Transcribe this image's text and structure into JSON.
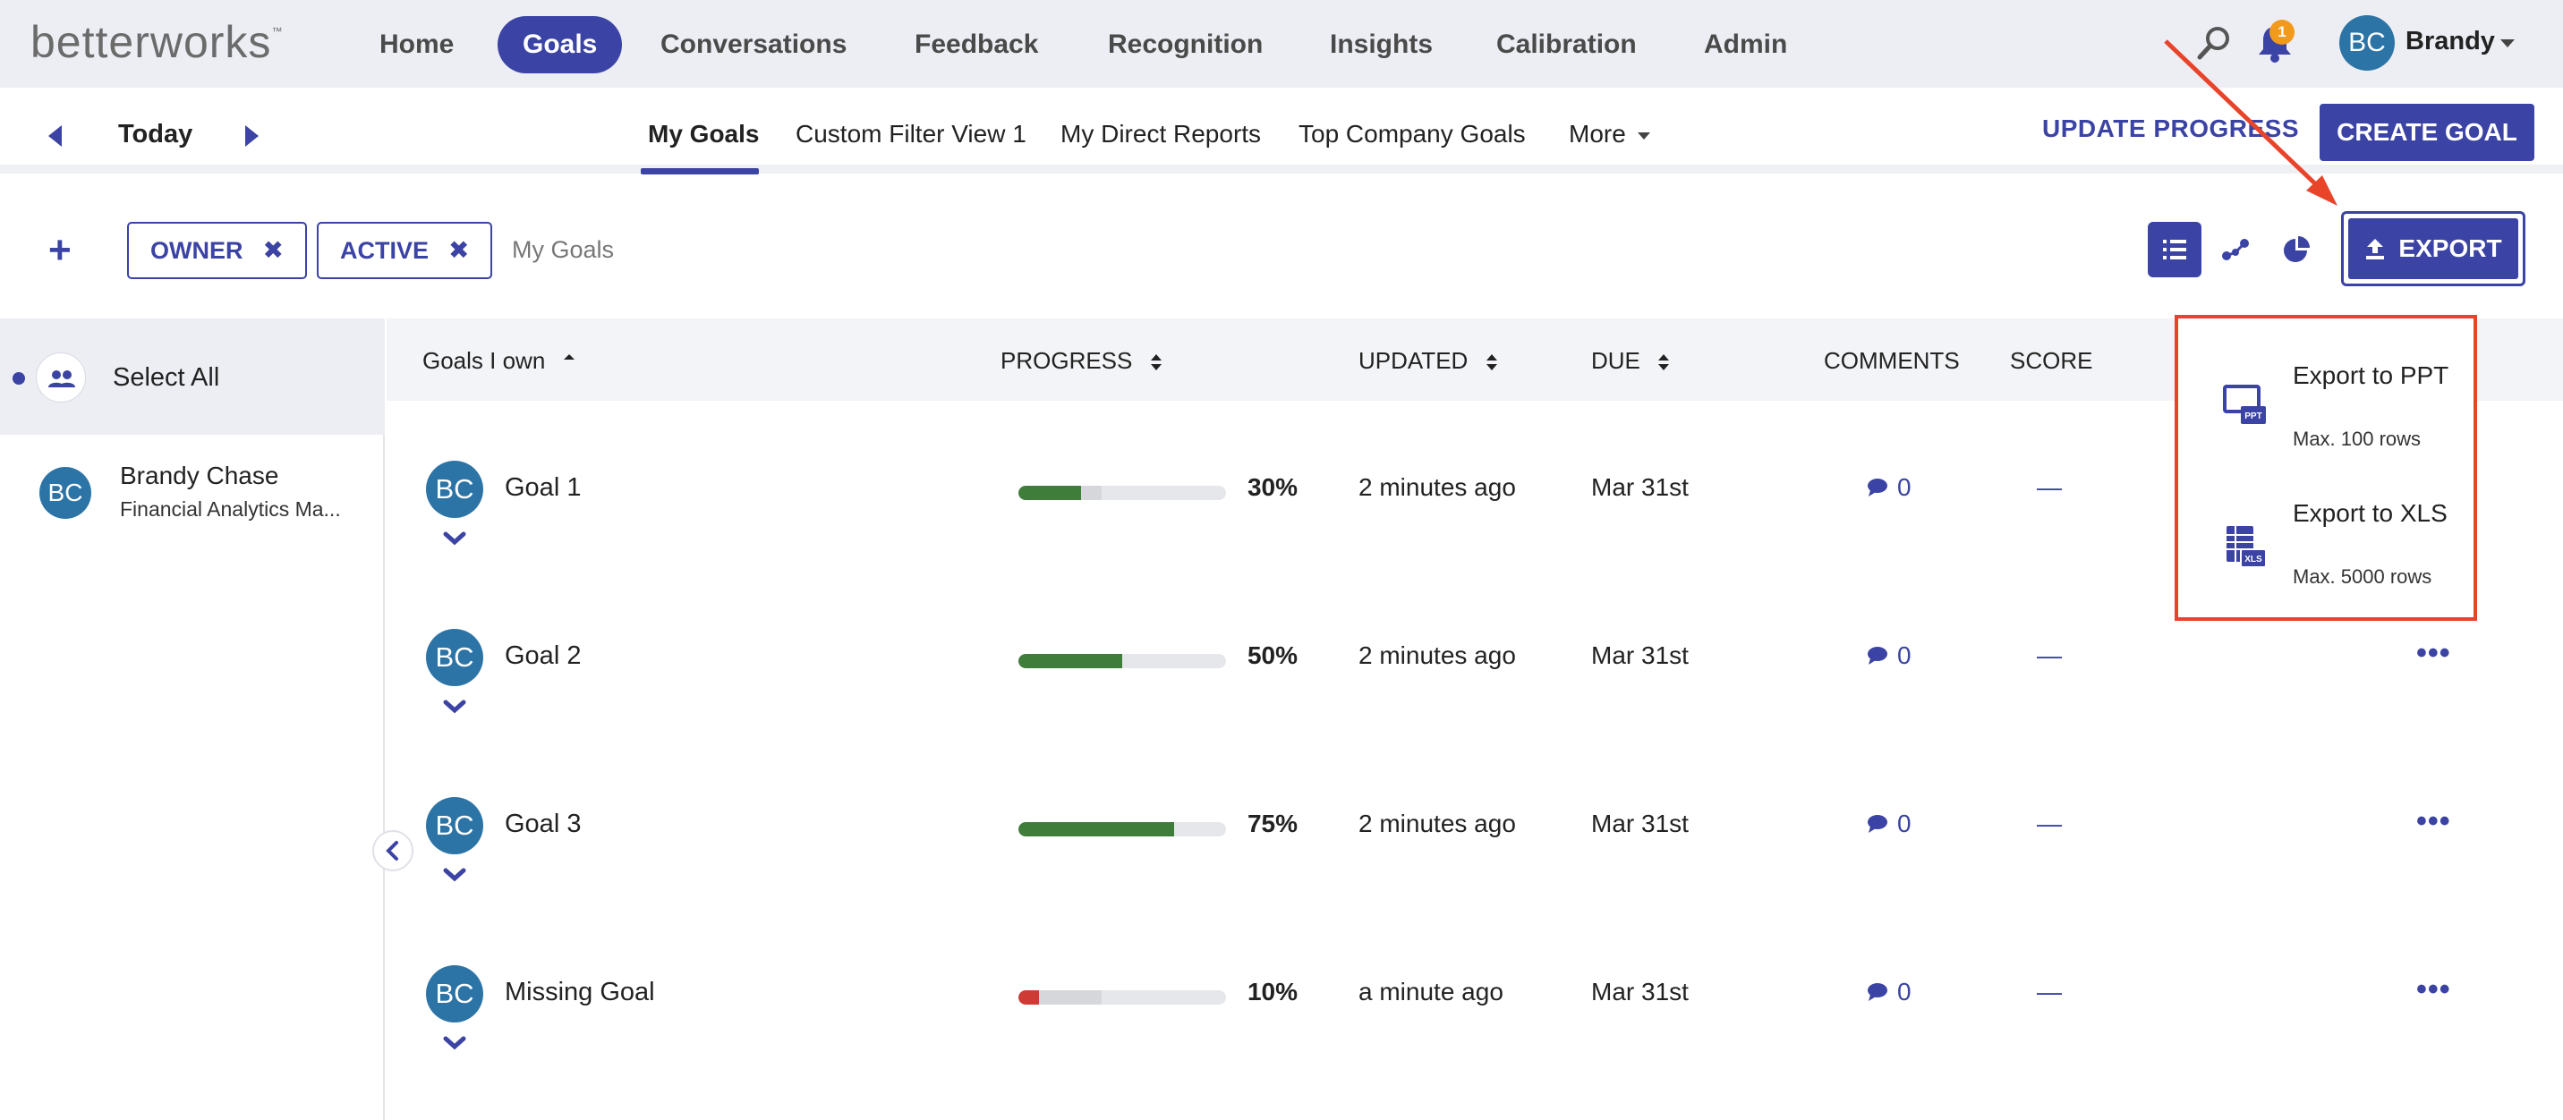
{
  "brand": {
    "logo_text": "betterworks",
    "tm": "™",
    "accent": "#3b43a4",
    "avatar_color": "#2d74a6",
    "highlight": "#e8442a"
  },
  "topnav": {
    "items": [
      {
        "label": "Home"
      },
      {
        "label": "Goals",
        "active": true
      },
      {
        "label": "Conversations"
      },
      {
        "label": "Feedback"
      },
      {
        "label": "Recognition"
      },
      {
        "label": "Insights"
      },
      {
        "label": "Calibration"
      },
      {
        "label": "Admin"
      }
    ],
    "search_icon": "search-icon",
    "bell_icon": "bell-icon",
    "notification_count": "1",
    "user_initials": "BC",
    "user_name": "Brandy"
  },
  "subnav": {
    "date_label": "Today",
    "tabs": [
      {
        "label": "My Goals",
        "active": true
      },
      {
        "label": "Custom Filter View 1"
      },
      {
        "label": "My Direct Reports"
      },
      {
        "label": "Top Company Goals"
      },
      {
        "label": "More"
      }
    ],
    "update_progress": "UPDATE PROGRESS",
    "create_goal": "CREATE GOAL"
  },
  "filters": {
    "add": "+",
    "chips": [
      {
        "label": "OWNER"
      },
      {
        "label": "ACTIVE"
      }
    ],
    "chip_remove_glyph": "✖",
    "current_view": "My Goals",
    "export_label": "EXPORT"
  },
  "people": {
    "select_all": "Select All",
    "person": {
      "initials": "BC",
      "name": "Brandy Chase",
      "title": "Financial Analytics Ma..."
    }
  },
  "table": {
    "columns": {
      "name": "Goals I own",
      "progress": "PROGRESS",
      "updated": "UPDATED",
      "due": "DUE",
      "comments": "COMMENTS",
      "score": "SCORE"
    },
    "rows": [
      {
        "initials": "BC",
        "name": "Goal 1",
        "progress": 0.3,
        "expected": 0.4,
        "status": "green",
        "progress_label": "30%",
        "updated": "2 minutes ago",
        "due": "Mar 31st",
        "comments": "0",
        "score": "—",
        "menu": "•••"
      },
      {
        "initials": "BC",
        "name": "Goal 2",
        "progress": 0.5,
        "expected": 0.4,
        "status": "green",
        "progress_label": "50%",
        "updated": "2 minutes ago",
        "due": "Mar 31st",
        "comments": "0",
        "score": "—",
        "menu": "•••"
      },
      {
        "initials": "BC",
        "name": "Goal 3",
        "progress": 0.75,
        "expected": 0.4,
        "status": "green",
        "progress_label": "75%",
        "updated": "2 minutes ago",
        "due": "Mar 31st",
        "comments": "0",
        "score": "—",
        "menu": "•••"
      },
      {
        "initials": "BC",
        "name": "Missing Goal",
        "progress": 0.1,
        "expected": 0.4,
        "status": "red",
        "progress_label": "10%",
        "updated": "a minute ago",
        "due": "Mar 31st",
        "comments": "0",
        "score": "—",
        "menu": "•••"
      }
    ]
  },
  "export_menu": {
    "items": [
      {
        "title": "Export to PPT",
        "sub": "Max. 100 rows",
        "icon": "ppt-file-icon",
        "badge": "PPT"
      },
      {
        "title": "Export to XLS",
        "sub": "Max. 5000 rows",
        "icon": "xls-file-icon",
        "badge": "XLS"
      }
    ]
  }
}
